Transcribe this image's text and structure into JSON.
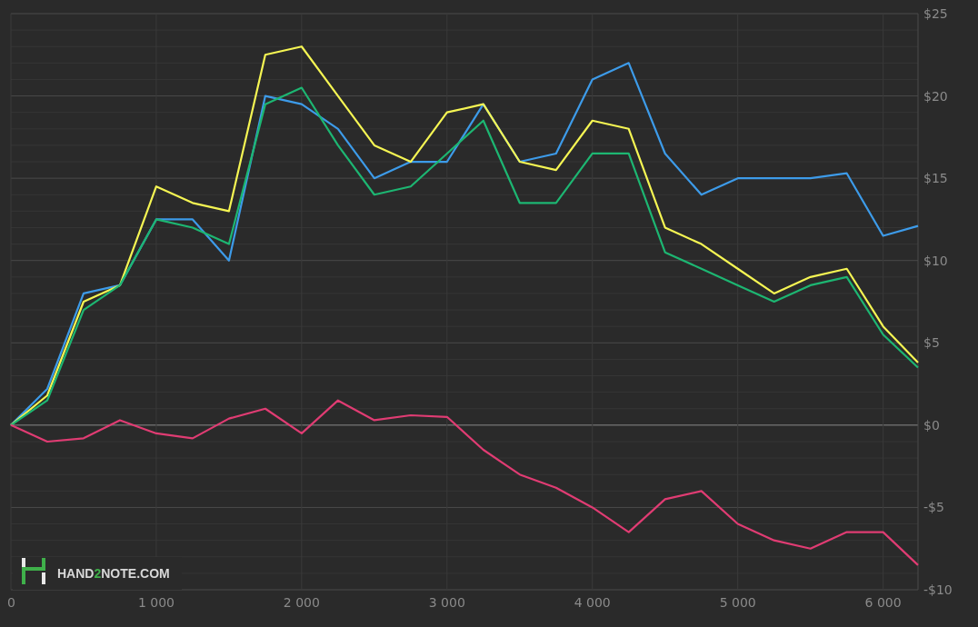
{
  "chart_data": {
    "type": "line",
    "x": [
      0,
      250,
      500,
      750,
      1000,
      1250,
      1500,
      1750,
      2000,
      2250,
      2500,
      2750,
      3000,
      3250,
      3500,
      3750,
      4000,
      4250,
      4500,
      4750,
      5000,
      5250,
      5500,
      5750,
      6000,
      6240
    ],
    "series": [
      {
        "color": "#3d9be9",
        "values": [
          0,
          2.2,
          8,
          8.5,
          12.5,
          12.5,
          10,
          20,
          19.5,
          18,
          15,
          16,
          16,
          19.5,
          16,
          16.5,
          21,
          22,
          16.5,
          14,
          15,
          15,
          15,
          15.3,
          11.5,
          12.1
        ]
      },
      {
        "color": "#f5f553",
        "values": [
          0,
          1.8,
          7.5,
          8.5,
          14.5,
          13.5,
          13,
          22.5,
          23,
          20,
          17,
          16,
          19,
          19.5,
          16,
          15.5,
          18.5,
          18,
          12,
          11,
          9.5,
          8,
          9,
          9.5,
          6,
          3.8
        ]
      },
      {
        "color": "#1db672",
        "values": [
          0,
          1.5,
          7,
          8.5,
          12.5,
          12,
          11,
          19.5,
          20.5,
          17,
          14,
          14.5,
          16.5,
          18.5,
          13.5,
          13.5,
          16.5,
          16.5,
          10.5,
          9.5,
          8.5,
          7.5,
          8.5,
          9,
          5.5,
          3.5
        ]
      },
      {
        "color": "#e03c73",
        "values": [
          0,
          -1,
          -0.8,
          0.3,
          -0.5,
          -0.8,
          0.4,
          1,
          -0.5,
          1.5,
          0.3,
          0.6,
          0.5,
          -1.5,
          -3,
          -3.8,
          -5,
          -6.5,
          -4.5,
          -4,
          -6,
          -7,
          -7.5,
          -6.5,
          -6.5,
          -8.5
        ]
      }
    ],
    "grid": true,
    "xlim": [
      0,
      6240
    ],
    "ylim": [
      -10,
      25
    ],
    "xticks": [
      {
        "value": 0,
        "label": "0"
      },
      {
        "value": 1000,
        "label": "1 000"
      },
      {
        "value": 2000,
        "label": "2 000"
      },
      {
        "value": 3000,
        "label": "3 000"
      },
      {
        "value": 4000,
        "label": "4 000"
      },
      {
        "value": 5000,
        "label": "5 000"
      },
      {
        "value": 6000,
        "label": "6 000"
      }
    ],
    "yticks": [
      {
        "value": 25,
        "label": "$25"
      },
      {
        "value": 20,
        "label": "$20"
      },
      {
        "value": 15,
        "label": "$15"
      },
      {
        "value": 10,
        "label": "$10"
      },
      {
        "value": 5,
        "label": "$5"
      },
      {
        "value": 0,
        "label": "$0"
      },
      {
        "value": -5,
        "label": "-$5"
      },
      {
        "value": -10,
        "label": "-$10"
      }
    ]
  },
  "brand": [
    "HAND",
    "2",
    "NOTE.COM"
  ]
}
